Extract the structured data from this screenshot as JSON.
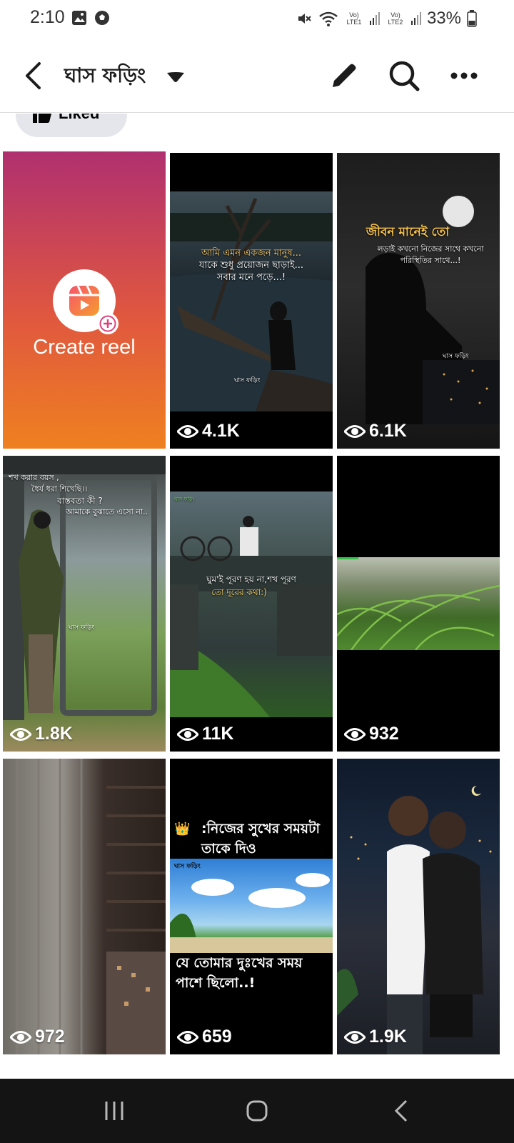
{
  "status_bar": {
    "time": "2:10",
    "lte1": "Vo) LTE1",
    "lte2": "Vo) LTE2",
    "battery": "33%"
  },
  "header": {
    "title": "ঘাস ফড়িং"
  },
  "filter_chip": {
    "label": "Liked"
  },
  "create_reel": {
    "label": "Create reel"
  },
  "reels": [
    {
      "views": "4.1K",
      "overlay": [
        "আমি এমন একজন মানুষ...",
        "যাকে শুধু প্রয়োজন ছাড়াই...",
        "সবার মনে পড়ে...!"
      ],
      "watermark": "ঘাস ফড়িং"
    },
    {
      "views": "6.1K",
      "headline": "জীবন মানেই তো",
      "overlay": [
        "লড়াই কখনো নিজের সাথে কখনো",
        "পরিস্থিতির সাথে...!"
      ],
      "watermark": "ঘাস ফড়িং"
    },
    {
      "views": "1.8K",
      "overlay": [
        "শখ করার বয়স ,",
        "ধৈর্য ধরা শিখেছি।।",
        "বাস্তবতা কী ?",
        "আমাকে বুঝাতে এসো না.."
      ],
      "watermark": "ঘাস ফড়িং"
    },
    {
      "views": "11K",
      "overlay": [
        "ঘুম'ই পূরণ হয় না,শখ পূরণ",
        "তো দূরের কথা:)"
      ],
      "watermark": "ঘাস ফড়িং"
    },
    {
      "views": "932"
    },
    {
      "views": "972"
    },
    {
      "views": "659",
      "caption_top": ":নিজের সুখের সময়টা তাকে দিও",
      "caption_bottom": "যে তোমার দুঃখের সময় পাশে ছিলো..!",
      "watermark": "ঘাস ফড়িং"
    },
    {
      "views": "1.9K"
    }
  ],
  "colors": {
    "accent": "#e0573f",
    "nav_bg": "#141414",
    "chip_bg": "#e4e6eb"
  }
}
